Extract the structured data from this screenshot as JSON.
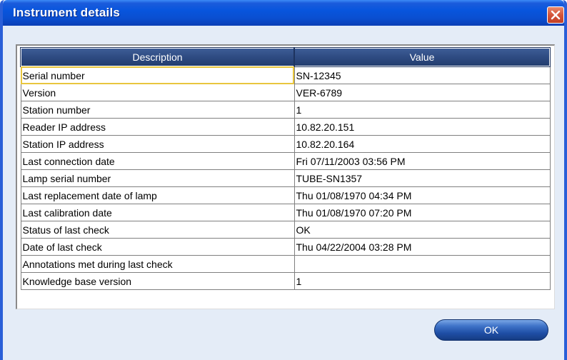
{
  "window": {
    "title": "Instrument details"
  },
  "table": {
    "columns": [
      "Description",
      "Value"
    ],
    "rows": [
      {
        "description": "Serial number",
        "value": "SN-12345"
      },
      {
        "description": "Version",
        "value": "VER-6789"
      },
      {
        "description": "Station number",
        "value": "1"
      },
      {
        "description": "Reader IP address",
        "value": "10.82.20.151"
      },
      {
        "description": "Station IP address",
        "value": "10.82.20.164"
      },
      {
        "description": "Last connection date",
        "value": "Fri 07/11/2003 03:56 PM"
      },
      {
        "description": "Lamp serial number",
        "value": "TUBE-SN1357"
      },
      {
        "description": "Last replacement date of lamp",
        "value": "Thu 01/08/1970 04:34 PM"
      },
      {
        "description": "Last calibration date",
        "value": "Thu 01/08/1970 07:20 PM"
      },
      {
        "description": "Status of last check",
        "value": "OK"
      },
      {
        "description": "Date of last check",
        "value": "Thu 04/22/2004 03:28 PM"
      },
      {
        "description": "Annotations met during last check",
        "value": ""
      },
      {
        "description": "Knowledge base version",
        "value": "1"
      }
    ]
  },
  "buttons": {
    "ok_label": "OK"
  },
  "colors": {
    "titlebar": "#0855dd",
    "header": "#2e4b82",
    "close": "#d4553a",
    "selection": "#e8c63e"
  }
}
